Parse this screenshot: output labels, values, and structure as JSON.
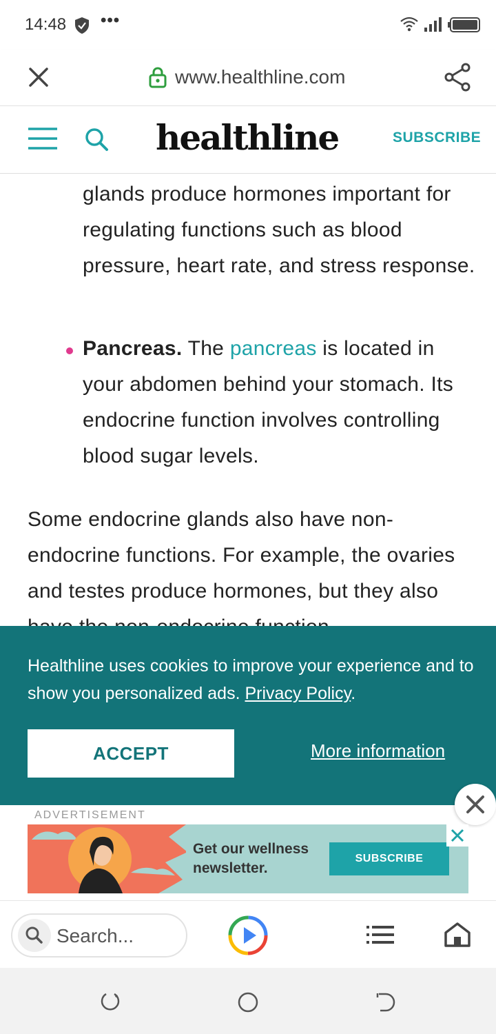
{
  "status_bar": {
    "time": "14:48",
    "dots": "•••"
  },
  "browser": {
    "url": "www.healthline.com"
  },
  "site": {
    "brand": "healthline",
    "subscribe": "SUBSCRIBE"
  },
  "article": {
    "adrenal_continuation": "glands produce hormones important for regulating functions such as blood pressure, heart rate, and stress response.",
    "pancreas_title": "Pancreas.",
    "pancreas_the": "The",
    "pancreas_link": "pancreas",
    "pancreas_rest": "is located in your abdomen behind your stomach. Its endocrine function involves controlling blood sugar levels.",
    "para": "Some endocrine glands also have non-endocrine functions. For example, the ovaries and testes produce hormones, but they also have the non-endocrine function"
  },
  "cookie_banner": {
    "text": "Healthline uses cookies to improve your experience and to show you personalized ads.",
    "privacy_link": "Privacy Policy",
    "period": ".",
    "accept": "ACCEPT",
    "more_info": "More information"
  },
  "ad": {
    "label": "ADVERTISEMENT",
    "headline": "Get our wellness newsletter.",
    "button": "SUBSCRIBE"
  },
  "toolbar": {
    "search_placeholder": "Search..."
  },
  "colors": {
    "teal": "#1ea3a8",
    "banner_bg": "#137479",
    "bullet": "#e03a8e"
  }
}
